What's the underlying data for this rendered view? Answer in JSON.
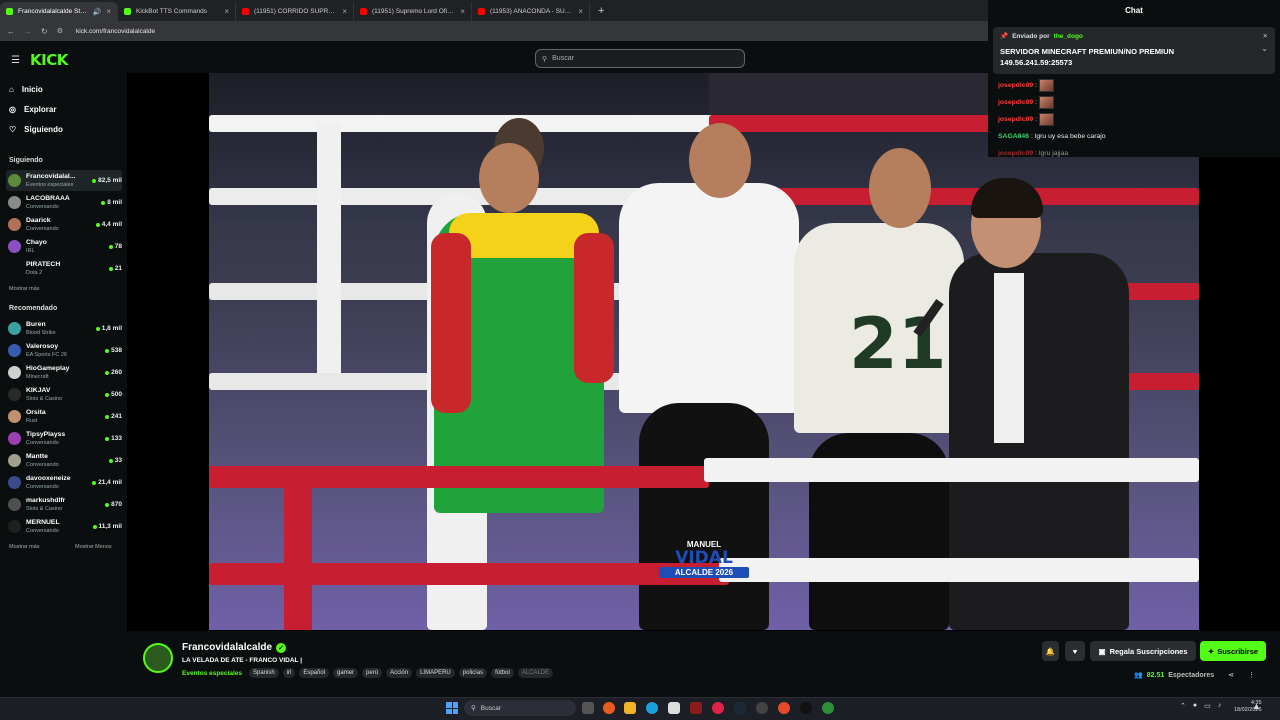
{
  "browser": {
    "tabs": [
      {
        "title": "Francovidalalcalde Stream",
        "favicon_color": "#53fc18",
        "active": true
      },
      {
        "title": "KickBot TTS Commands",
        "favicon_color": "#53fc18",
        "active": false
      },
      {
        "title": "(11951) CORRIDO SUPREMO",
        "favicon_color": "#ff0000",
        "active": false
      },
      {
        "title": "(11951) Supremo Lord Oficial",
        "favicon_color": "#ff0000",
        "active": false
      },
      {
        "title": "(11953) ANACONDA - SUPREM",
        "favicon_color": "#ff0000",
        "active": false
      }
    ],
    "url": "kick.com/francovidalalcalde"
  },
  "site": {
    "logo": "KICK",
    "search_placeholder": "Buscar",
    "nav": [
      {
        "label": "Inicio",
        "icon": "home-icon"
      },
      {
        "label": "Explorar",
        "icon": "compass-icon"
      },
      {
        "label": "Siguiendo",
        "icon": "heart-icon"
      }
    ]
  },
  "sidebar": {
    "following_title": "Siguiendo",
    "following": [
      {
        "name": "Francovidalal...",
        "category": "Eventos especiales",
        "viewers": "82,5 mil",
        "color": "#5a8a3a"
      },
      {
        "name": "LACOBRAAA",
        "category": "Conversando",
        "viewers": "8 mil",
        "color": "#8a8a8a"
      },
      {
        "name": "Daarick",
        "category": "Conversando",
        "viewers": "4,4 mil",
        "color": "#b0705a"
      },
      {
        "name": "Chayo",
        "category": "IRL",
        "viewers": "78",
        "color": "#8a4fc0"
      },
      {
        "name": "PIRATECH",
        "category": "Dota 2",
        "viewers": "21",
        "color": "#0b0e0f"
      }
    ],
    "show_more": "Mostrar más",
    "recommended_title": "Recomendado",
    "recommended": [
      {
        "name": "Buren",
        "category": "Blood Strike",
        "viewers": "1,8 mil",
        "color": "#3aa0a0"
      },
      {
        "name": "Valerosoy",
        "category": "EA Sports FC 26",
        "viewers": "538",
        "color": "#3a5ab0"
      },
      {
        "name": "HioGameplay",
        "category": "Minecraft",
        "viewers": "260",
        "color": "#d0d0d0"
      },
      {
        "name": "KIKJAV",
        "category": "Slots & Casino",
        "viewers": "500",
        "color": "#2a2a2a"
      },
      {
        "name": "Orsita",
        "category": "Rust",
        "viewers": "241",
        "color": "#c09070"
      },
      {
        "name": "TipsyPlayss",
        "category": "Conversando",
        "viewers": "133",
        "color": "#9a40b0"
      },
      {
        "name": "Mantte",
        "category": "Conversando",
        "viewers": "33",
        "color": "#a0a090"
      },
      {
        "name": "davooxeneize",
        "category": "Conversando",
        "viewers": "21,4 mil",
        "color": "#3a4a8a"
      },
      {
        "name": "markushdlfr",
        "category": "Slots & Casino",
        "viewers": "870",
        "color": "#505050"
      },
      {
        "name": "MERNUEL",
        "category": "Conversando",
        "viewers": "11,3 mil",
        "color": "#202020"
      }
    ],
    "show_more_2": "Mostrar más",
    "show_less": "Mostrar Menos"
  },
  "chat": {
    "title": "Chat",
    "pinned_label": "Enviado por",
    "pinned_user": "the_dogo",
    "pinned_message": "SERVIDOR MINECRAFT PREMIUN/NO PREMIUN 149.56.241.59:25573",
    "messages": [
      {
        "user": "josepdlc09",
        "user_color": "#ff3b3b",
        "text": ""
      },
      {
        "user": "josepdlc09",
        "user_color": "#ff3b3b",
        "text": ""
      },
      {
        "user": "josepdlc09",
        "user_color": "#ff3b3b",
        "text": ""
      },
      {
        "user": "SAGA846",
        "user_color": "#3bd16f",
        "text": "lgru uy esa bebe carajo"
      },
      {
        "user": "josepdlc09",
        "user_color": "#ff3b3b",
        "text": "lgru jajjaa"
      }
    ]
  },
  "video": {
    "overlay_line1": "MANUEL",
    "overlay_line2": "VIDAL",
    "overlay_line3": "ALCALDE 2026",
    "jersey_number": "21"
  },
  "stream_info": {
    "channel": "Francovidalalcalde",
    "title": "LA VELADA DE ATE - FRANCO VIDAL |",
    "category": "Eventos especiales",
    "tags": [
      "Spanish",
      "irl",
      "Español",
      "gamer",
      "perú",
      "Acción",
      "LIMAPERU",
      "policías",
      "fútbol",
      "ALCALDE"
    ],
    "viewers": "82.51",
    "viewers_label": "Espectadores",
    "gift_button": "Regala Suscripciones",
    "subscribe_button": "Suscribirse"
  },
  "taskbar": {
    "search_placeholder": "Buscar",
    "time": "4:35",
    "date": "18/02/2026"
  }
}
